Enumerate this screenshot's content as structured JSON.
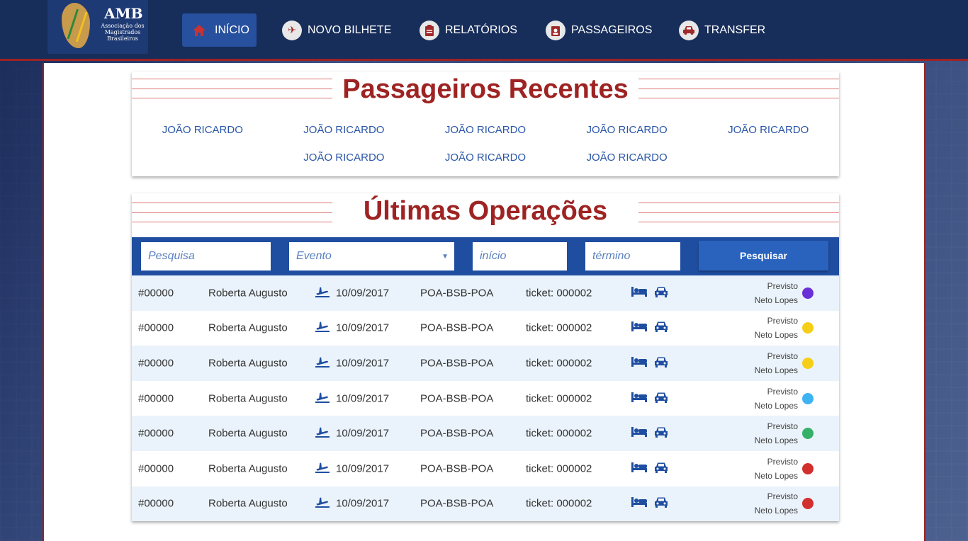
{
  "logo": {
    "brand": "AMB",
    "subtitle": "Associação dos Magistrados Brasileiros"
  },
  "nav": [
    {
      "label": "INÍCIO",
      "icon": "home-icon",
      "active": true
    },
    {
      "label": "NOVO BILHETE",
      "icon": "airplane-icon",
      "active": false
    },
    {
      "label": "RELATÓRIOS",
      "icon": "clipboard-icon",
      "active": false
    },
    {
      "label": "PASSAGEIROS",
      "icon": "id-badge-icon",
      "active": false
    },
    {
      "label": "TRANSFER",
      "icon": "car-icon",
      "active": false
    }
  ],
  "recent": {
    "title": "Passageiros Recentes",
    "passengers": [
      "JOÃO RICARDO",
      "JOÃO RICARDO",
      "JOÃO RICARDO",
      "JOÃO RICARDO",
      "JOÃO RICARDO",
      "JOÃO RICARDO",
      "JOÃO RICARDO",
      "JOÃO RICARDO"
    ]
  },
  "operations": {
    "title": "Últimas Operações",
    "search": {
      "search_placeholder": "Pesquisa",
      "event_placeholder": "Evento",
      "start_placeholder": "início",
      "end_placeholder": "término",
      "button": "Pesquisar"
    },
    "rows": [
      {
        "id": "#00000",
        "name": "Roberta Augusto",
        "date": "10/09/2017",
        "route": "POA-BSB-POA",
        "ticket": "ticket: 000002",
        "status": "Previsto",
        "agent": "Neto Lopes",
        "color": "#6a2fd6"
      },
      {
        "id": "#00000",
        "name": "Roberta Augusto",
        "date": "10/09/2017",
        "route": "POA-BSB-POA",
        "ticket": "ticket: 000002",
        "status": "Previsto",
        "agent": "Neto Lopes",
        "color": "#f5cf17"
      },
      {
        "id": "#00000",
        "name": "Roberta Augusto",
        "date": "10/09/2017",
        "route": "POA-BSB-POA",
        "ticket": "ticket: 000002",
        "status": "Previsto",
        "agent": "Neto Lopes",
        "color": "#f5cf17"
      },
      {
        "id": "#00000",
        "name": "Roberta Augusto",
        "date": "10/09/2017",
        "route": "POA-BSB-POA",
        "ticket": "ticket: 000002",
        "status": "Previsto",
        "agent": "Neto Lopes",
        "color": "#3db3f2"
      },
      {
        "id": "#00000",
        "name": "Roberta Augusto",
        "date": "10/09/2017",
        "route": "POA-BSB-POA",
        "ticket": "ticket: 000002",
        "status": "Previsto",
        "agent": "Neto Lopes",
        "color": "#35b069"
      },
      {
        "id": "#00000",
        "name": "Roberta Augusto",
        "date": "10/09/2017",
        "route": "POA-BSB-POA",
        "ticket": "ticket: 000002",
        "status": "Previsto",
        "agent": "Neto Lopes",
        "color": "#d22f2f"
      },
      {
        "id": "#00000",
        "name": "Roberta Augusto",
        "date": "10/09/2017",
        "route": "POA-BSB-POA",
        "ticket": "ticket: 000002",
        "status": "Previsto",
        "agent": "Neto Lopes",
        "color": "#d22f2f"
      }
    ]
  },
  "colors": {
    "navy": "#172d5a",
    "accent_red": "#9e2323",
    "blue": "#1f4ea1",
    "row_alt": "#eaf3fb"
  }
}
